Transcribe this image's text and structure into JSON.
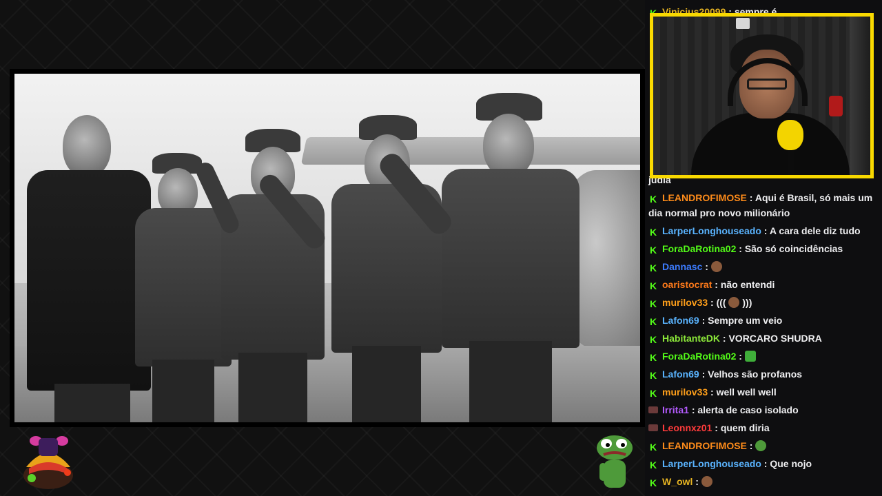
{
  "stream": {
    "main_image_alt": "",
    "colors": {
      "webcam_border": "#f9d900",
      "badge": "#53fc18",
      "chat_bg": "#0e0e10"
    }
  },
  "chat": {
    "messages": [
      {
        "user": "Vinicius20099",
        "user_color": "#e6b422",
        "text": "sempre é",
        "badge": "kick"
      },
      {
        "user": "",
        "user_color": "#efeff1",
        "text": "judia",
        "badge": "none"
      },
      {
        "user": "LEANDROFIMOSE",
        "user_color": "#ff8c1a",
        "text": "Aqui é Brasil, só mais um dia normal pro novo milionário",
        "badge": "kick"
      },
      {
        "user": "LarperLonghouseado",
        "user_color": "#5ab4ff",
        "text": "A cara dele diz tudo",
        "badge": "kick"
      },
      {
        "user": "ForaDaRotina02",
        "user_color": "#53fc18",
        "text": "São só coincidências",
        "badge": "kick"
      },
      {
        "user": "Dannasc",
        "user_color": "#3d7cff",
        "text": "",
        "badge": "kick",
        "emote": "emote"
      },
      {
        "user": "oaristocrat",
        "user_color": "#ff7a1a",
        "text": "não entendi",
        "badge": "kick"
      },
      {
        "user": "murilov33",
        "user_color": "#ff9f1a",
        "text": "(((  )))",
        "badge": "kick",
        "emote": "emote"
      },
      {
        "user": "Lafon69",
        "user_color": "#5ab4ff",
        "text": "Sempre um veio",
        "badge": "kick"
      },
      {
        "user": "HabitanteDK",
        "user_color": "#8dea3a",
        "text": "VORCARO SHUDRA",
        "badge": "kick"
      },
      {
        "user": "ForaDaRotina02",
        "user_color": "#53fc18",
        "text": "",
        "badge": "kick",
        "emote": "money-emote"
      },
      {
        "user": "Lafon69",
        "user_color": "#5ab4ff",
        "text": "Velhos são profanos",
        "badge": "kick"
      },
      {
        "user": "murilov33",
        "user_color": "#ff9f1a",
        "text": "well well well",
        "badge": "kick"
      },
      {
        "user": "Irrita1",
        "user_color": "#b45bff",
        "text": "alerta de caso isolado",
        "badge": "alt"
      },
      {
        "user": "Leonnxz01",
        "user_color": "#ff3b3b",
        "text": "quem diria",
        "badge": "alt"
      },
      {
        "user": "LEANDROFIMOSE",
        "user_color": "#ff8c1a",
        "text": "",
        "badge": "kick",
        "emote": "cup-emote"
      },
      {
        "user": "LarperLonghouseado",
        "user_color": "#5ab4ff",
        "text": "Que nojo",
        "badge": "kick"
      },
      {
        "user": "W_owl",
        "user_color": "#e6b422",
        "text": "",
        "badge": "kick",
        "emote": "emote"
      }
    ],
    "separator": ":"
  },
  "emotes": {
    "left": "hat-character-emote",
    "right": "pepe-frog-emote"
  }
}
